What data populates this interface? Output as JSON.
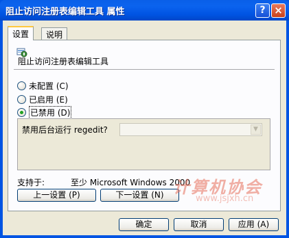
{
  "window": {
    "title": "阻止访问注册表编辑工具 属性",
    "help_symbol": "?",
    "close_symbol": "×"
  },
  "tabs": [
    {
      "label": "设置"
    },
    {
      "label": "说明"
    }
  ],
  "policy": {
    "name": "阻止访问注册表编辑工具",
    "icon": "policy-setting-icon"
  },
  "radios": [
    {
      "label": "未配置 (C)",
      "checked": false
    },
    {
      "label": "已启用 (E)",
      "checked": false
    },
    {
      "label": "已禁用 (D)",
      "checked": true
    }
  ],
  "option": {
    "label": "禁用后台运行 regedit?",
    "value": ""
  },
  "supported": {
    "label": "支持于:",
    "value": "至少 Microsoft Windows 2000"
  },
  "buttons": {
    "prev": "上一设置 (P)",
    "next": "下一设置 (N)",
    "ok": "确定",
    "cancel": "取消",
    "apply": "应用 (A)"
  },
  "watermark": {
    "text": "计算机协会",
    "sub": "www.jsjxh.cn"
  }
}
